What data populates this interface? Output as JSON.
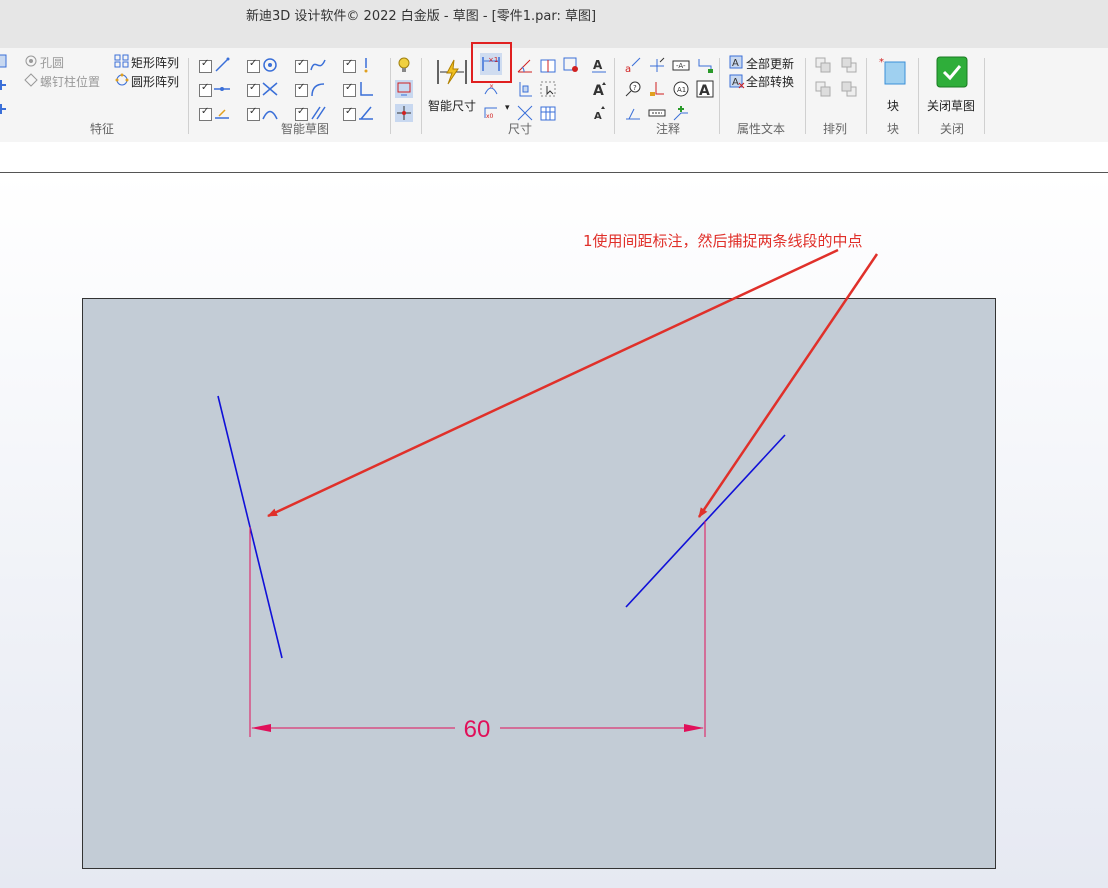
{
  "window": {
    "title": "新迪3D 设计软件© 2022 白金版 - 草图 - [零件1.par: 草图]"
  },
  "ribbon": {
    "features": {
      "label": "特征",
      "hole": "孔圆",
      "thread_position": "螺钉柱位置",
      "rect_pattern": "矩形阵列",
      "circ_pattern": "圆形阵列"
    },
    "smart_sketch": {
      "label": "智能草图"
    },
    "dimension": {
      "label": "尺寸",
      "smart_dim": "智能尺寸"
    },
    "annotation": {
      "label": "注释"
    },
    "property_text": {
      "label": "属性文本",
      "update_all": "全部更新",
      "convert_all": "全部转换"
    },
    "arrange": {
      "label": "排列"
    },
    "block": {
      "label": "块",
      "button": "块"
    },
    "close": {
      "label": "关闭",
      "button": "关闭草图"
    }
  },
  "canvas": {
    "annotation_text": "1使用间距标注，然后捕捉两条线段的中点",
    "dimension_value": "60",
    "colors": {
      "sheet": "#c3ccd6",
      "sketch_line": "#1010d8",
      "dimension": "#e0105a",
      "annotation": "#e0302a"
    }
  }
}
